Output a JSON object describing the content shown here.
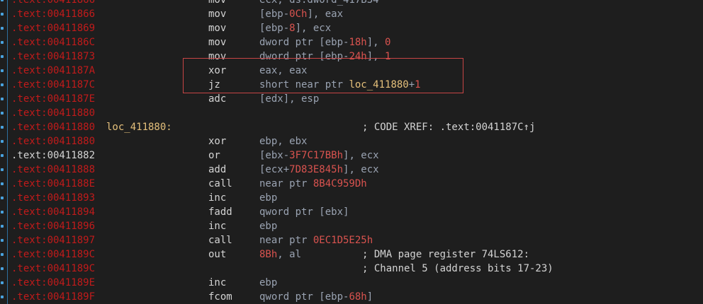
{
  "colors": {
    "background": "#1e1e1e",
    "address": "#c11b1b",
    "label": "#e5c07b",
    "number": "#d9534f",
    "highlight_border": "#c84545"
  },
  "rows": [
    {
      "addr": ".text:00411866",
      "mnem": "mov",
      "ops": [
        {
          "t": "ecx, ds:dword_417B34",
          "c": ""
        }
      ]
    },
    {
      "addr": ".text:00411866",
      "mnem": "mov",
      "ops": [
        {
          "t": "[ebp-",
          "c": ""
        },
        {
          "t": "0Ch",
          "c": "num"
        },
        {
          "t": "], eax",
          "c": ""
        }
      ]
    },
    {
      "addr": ".text:00411869",
      "mnem": "mov",
      "ops": [
        {
          "t": "[ebp-",
          "c": ""
        },
        {
          "t": "8",
          "c": "num"
        },
        {
          "t": "], ecx",
          "c": ""
        }
      ]
    },
    {
      "addr": ".text:0041186C",
      "mnem": "mov",
      "ops": [
        {
          "t": "dword ptr [ebp-",
          "c": ""
        },
        {
          "t": "18h",
          "c": "num"
        },
        {
          "t": "], ",
          "c": ""
        },
        {
          "t": "0",
          "c": "num"
        }
      ]
    },
    {
      "addr": ".text:00411873",
      "mnem": "mov",
      "ops": [
        {
          "t": "dword ptr [ebp-",
          "c": ""
        },
        {
          "t": "24h",
          "c": "num"
        },
        {
          "t": "], ",
          "c": ""
        },
        {
          "t": "1",
          "c": "num"
        }
      ]
    },
    {
      "addr": ".text:0041187A",
      "mnem": "xor",
      "ops": [
        {
          "t": "eax, eax",
          "c": ""
        }
      ]
    },
    {
      "addr": ".text:0041187C",
      "mnem": "jz",
      "ops": [
        {
          "t": "short near ptr ",
          "c": ""
        },
        {
          "t": "loc_411880",
          "c": "ref"
        },
        {
          "t": "+",
          "c": ""
        },
        {
          "t": "1",
          "c": "num"
        }
      ]
    },
    {
      "addr": ".text:0041187E",
      "mnem": "adc",
      "ops": [
        {
          "t": "[edx], esp",
          "c": ""
        }
      ]
    },
    {
      "addr": ".text:00411880",
      "mnem": "",
      "ops": []
    },
    {
      "addr": ".text:00411880",
      "label": "loc_411880:",
      "mnem": "",
      "ops": [],
      "comment": "; CODE XREF: .text:0041187C↑j"
    },
    {
      "addr": ".text:00411880",
      "mnem": "xor",
      "ops": [
        {
          "t": "ebp, ebx",
          "c": ""
        }
      ]
    },
    {
      "addr": ".text:00411882",
      "addr_white": true,
      "mnem": "or",
      "ops": [
        {
          "t": "[ebx-",
          "c": ""
        },
        {
          "t": "3F7C17BBh",
          "c": "num"
        },
        {
          "t": "], ecx",
          "c": ""
        }
      ]
    },
    {
      "addr": ".text:00411888",
      "mnem": "add",
      "ops": [
        {
          "t": "[ecx+",
          "c": ""
        },
        {
          "t": "7D83E845h",
          "c": "num"
        },
        {
          "t": "], ecx",
          "c": ""
        }
      ]
    },
    {
      "addr": ".text:0041188E",
      "mnem": "call",
      "ops": [
        {
          "t": "near ptr ",
          "c": ""
        },
        {
          "t": "8B4C959Dh",
          "c": "num"
        }
      ]
    },
    {
      "addr": ".text:00411893",
      "mnem": "inc",
      "ops": [
        {
          "t": "ebp",
          "c": ""
        }
      ]
    },
    {
      "addr": ".text:00411894",
      "mnem": "fadd",
      "ops": [
        {
          "t": "qword ptr [ebx]",
          "c": ""
        }
      ]
    },
    {
      "addr": ".text:00411896",
      "mnem": "inc",
      "ops": [
        {
          "t": "ebp",
          "c": ""
        }
      ]
    },
    {
      "addr": ".text:00411897",
      "mnem": "call",
      "ops": [
        {
          "t": "near ptr ",
          "c": ""
        },
        {
          "t": "0EC1D5E25h",
          "c": "num"
        }
      ]
    },
    {
      "addr": ".text:0041189C",
      "mnem": "out",
      "ops": [
        {
          "t": "8Bh",
          "c": "num"
        },
        {
          "t": ", al",
          "c": ""
        }
      ],
      "comment": "; DMA page register 74LS612:"
    },
    {
      "addr": ".text:0041189C",
      "mnem": "",
      "ops": [],
      "comment": "; Channel 5 (address bits 17-23)"
    },
    {
      "addr": ".text:0041189E",
      "mnem": "inc",
      "ops": [
        {
          "t": "ebp",
          "c": ""
        }
      ]
    },
    {
      "addr": ".text:0041189F",
      "mnem": "fcom",
      "ops": [
        {
          "t": "qword ptr [ebp-",
          "c": ""
        },
        {
          "t": "68h",
          "c": "num"
        },
        {
          "t": "]",
          "c": ""
        }
      ]
    }
  ]
}
